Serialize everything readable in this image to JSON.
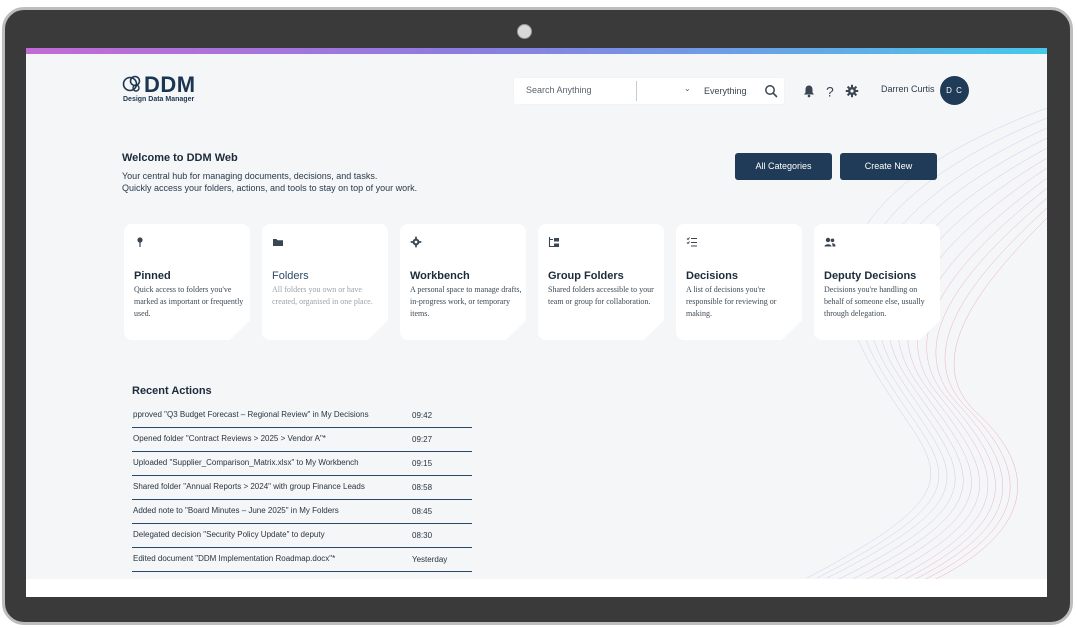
{
  "app": {
    "name": "DDM",
    "subtitle": "Design Data Manager"
  },
  "search": {
    "placeholder": "Search Anything",
    "scope": "Everything"
  },
  "user": {
    "name": "Darren Curtis",
    "initials": "D C"
  },
  "welcome": {
    "title": "Welcome to DDM Web",
    "line1": "Your central hub for managing documents, decisions, and tasks.",
    "line2": "Quickly access your folders, actions, and tools to stay on top of your work."
  },
  "buttons": {
    "all_categories": "All Categories",
    "create_new": "Create New"
  },
  "cards": [
    {
      "title": "Pinned",
      "icon": "pin-icon",
      "desc": "Quick access to folders you've marked as important or frequently used."
    },
    {
      "title": "Folders",
      "icon": "folder-icon",
      "desc": "All folders you own or have created, organised in one place."
    },
    {
      "title": "Workbench",
      "icon": "gear-icon",
      "desc": "A personal space to manage drafts, in-progress work, or temporary items."
    },
    {
      "title": "Group Folders",
      "icon": "group-folders-icon",
      "desc": "Shared folders accessible to your team or group for collaboration."
    },
    {
      "title": "Decisions",
      "icon": "checklist-icon",
      "desc": "A list of decisions you're responsible for reviewing or making."
    },
    {
      "title": "Deputy Decisions",
      "icon": "users-icon",
      "desc": "Decisions you're handling on behalf of someone else, usually through delegation."
    }
  ],
  "recent": {
    "title": "Recent Actions",
    "items": [
      {
        "text": "pproved \"Q3 Budget Forecast – Regional Review\" in My Decisions",
        "time": "09:42"
      },
      {
        "text": "Opened folder \"Contract Reviews > 2025 > Vendor A\"*",
        "time": "09:27"
      },
      {
        "text": "Uploaded \"Supplier_Comparison_Matrix.xlsx\" to My Workbench",
        "time": "09:15"
      },
      {
        "text": "Shared folder \"Annual Reports > 2024\" with group Finance Leads",
        "time": "08:58"
      },
      {
        "text": "Added note to \"Board Minutes – June 2025\" in My Folders",
        "time": "08:45"
      },
      {
        "text": "Delegated decision \"Security Policy Update\" to deputy",
        "time": "08:30"
      },
      {
        "text": "Edited document \"DDM Implementation Roadmap.docx\"*",
        "time": "Yesterday"
      }
    ]
  },
  "colors": {
    "primary": "#1f3b57",
    "gradient_start": "#c36ad6",
    "gradient_end": "#46c8ea",
    "background": "#f4f6f8"
  }
}
